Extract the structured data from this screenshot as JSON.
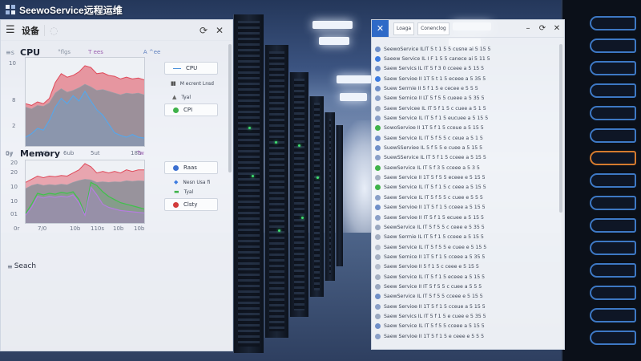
{
  "app": {
    "title": "SeewoService远程运维"
  },
  "device_panel": {
    "title": "设备",
    "faint_icon": "circle-icon",
    "header_buttons": [
      "refresh-icon",
      "close-icon"
    ]
  },
  "cpu": {
    "heading": "CPU",
    "icon_text": "≡s",
    "meta": [
      "°flgs",
      "T ees",
      "A ^ee"
    ],
    "x_ticks": [
      "0y",
      "10b",
      "6ub",
      "5ut",
      "18b"
    ],
    "y_ticks": [
      "10",
      "8",
      "2"
    ],
    "legend_buttons": [
      "CPU",
      "CPI"
    ],
    "legend_rows": [
      "M ecrent Lnsd",
      "Tyal"
    ],
    "colors": {
      "top": "#e04a5a",
      "mid": "#8a8f99",
      "low": "#58a6e8"
    }
  },
  "memory": {
    "heading": "Memory",
    "icon_text": "oy",
    "meta": [
      "Tw"
    ],
    "x_ticks": [
      "0r",
      "7/0",
      "10b",
      "110s",
      "10b",
      "10b"
    ],
    "y_ticks": [
      "20",
      "20",
      "10",
      "10",
      "01"
    ],
    "legend_buttons": [
      "Raas",
      "Clsty"
    ],
    "legend_rows": [
      "Nesn Usa fi",
      "Tyal"
    ],
    "colors": {
      "top": "#e04a5a",
      "mid": "#8a8f99",
      "green": "#3fc24a",
      "purple": "#b67ce0"
    }
  },
  "search": {
    "label": "Seach",
    "icon": "≡"
  },
  "chart_data": [
    {
      "type": "area",
      "title": "CPU",
      "xlabel": "",
      "ylabel": "",
      "x": [
        0,
        1,
        2,
        3,
        4,
        5,
        6,
        7,
        8,
        9,
        10,
        11,
        12,
        13,
        14,
        15,
        16,
        17,
        18,
        19,
        20
      ],
      "series": [
        {
          "values": [
            4.8,
            4.6,
            5.0,
            4.8,
            5.4,
            7.2,
            8.2,
            7.8,
            8.0,
            8.4,
            9.1,
            8.9,
            8.2,
            8.3,
            8.0,
            7.9,
            7.6,
            7.8,
            7.6,
            7.7,
            7.5
          ]
        },
        {
          "values": [
            4.4,
            4.2,
            4.6,
            4.5,
            4.9,
            6.0,
            6.5,
            6.1,
            6.3,
            6.6,
            7.0,
            6.7,
            6.3,
            6.4,
            6.2,
            6.0,
            5.8,
            6.0,
            5.9,
            6.0,
            5.8
          ]
        },
        {
          "values": [
            1.0,
            1.4,
            2.0,
            1.8,
            2.9,
            4.4,
            5.4,
            4.8,
            5.7,
            5.1,
            6.2,
            5.1,
            4.1,
            3.5,
            2.5,
            1.5,
            1.2,
            1.0,
            1.3,
            1.0,
            0.9
          ]
        }
      ]
    },
    {
      "type": "area",
      "title": "Memory",
      "xlabel": "",
      "ylabel": "",
      "x": [
        0,
        1,
        2,
        3,
        4,
        5,
        6,
        7,
        8,
        9,
        10,
        11,
        12,
        13,
        14,
        15,
        16,
        17,
        18,
        19,
        20
      ],
      "series": [
        {
          "values": [
            13,
            14,
            15,
            14.5,
            15,
            14.8,
            15.2,
            15,
            16,
            17,
            19,
            18,
            16,
            16.5,
            16,
            16.5,
            16,
            17,
            16.5,
            17,
            17
          ]
        },
        {
          "values": [
            11,
            12,
            12.5,
            12,
            12.3,
            12.1,
            12.4,
            12.2,
            13,
            13.6,
            14,
            13.8,
            13,
            13.2,
            13,
            13.2,
            13.1,
            13.5,
            13.3,
            13.5,
            13.4
          ]
        },
        {
          "values": [
            3,
            6,
            9.5,
            9,
            9.5,
            9.2,
            9.8,
            9.5,
            10,
            7.5,
            3,
            13,
            12,
            10,
            8.5,
            7.5,
            6.5,
            6,
            5.5,
            5,
            4.5
          ]
        },
        {
          "values": [
            2.5,
            5,
            8.5,
            8,
            8.5,
            8.2,
            8.6,
            8.3,
            9,
            6.5,
            2.5,
            11.5,
            9,
            6,
            5,
            4.5,
            4,
            3.8,
            3.6,
            3.4,
            3.2
          ]
        }
      ]
    }
  ],
  "log_panel": {
    "tabs": [
      "Loaga",
      "Conenclog"
    ],
    "window_buttons": [
      "minimize-icon",
      "restore-icon",
      "close-icon"
    ],
    "items": [
      {
        "text": "SeewoService  ILIT 5 t 1 5 5 cusne ai 5 15 5",
        "color": "#6f8fc8"
      },
      {
        "text": "Saeew Service  IL I F 1 5 5  canece ai 5 11 5",
        "color": "#3c7be0"
      },
      {
        "text": "Saew Servics  IL IT 5 f 3 0  cceee a 5 15 5",
        "color": "#6f8fc8"
      },
      {
        "text": "Saew Servioe  II 1T 5 t 1 5  eceee a 5 35 5",
        "color": "#3c7be0"
      },
      {
        "text": "Suew Serrnie  II  5 f 1 5  e cecee e 5 5 5",
        "color": "#6f8fc8"
      },
      {
        "text": "Saew Sernice  II LT 5 f 5 5  cueee a 5 35 5",
        "color": "#8aa0c8"
      },
      {
        "text": "Saew Servicee  IL IT 5 f 1 5  c cuee a 5 1 5",
        "color": "#9aa8c0"
      },
      {
        "text": "Saew Service  IL IT 5 f 1 5  eucuee a 5 15 5",
        "color": "#8aa0c8"
      },
      {
        "text": "SowoServioe  II 1T 5 f 1 5  cceue a 5 15 5",
        "color": "#3fb24a"
      },
      {
        "text": "Saew Service  IL IT 5 f 5 5  c ceue a 5 1 5",
        "color": "#6f8fc8"
      },
      {
        "text": "SuewSServiee  IL  5 f 5 5  e cuee a 5 15 5",
        "color": "#6f8fc8"
      },
      {
        "text": "SuewSService  IL IT 5 f 1 5  cceee a 5 15 5",
        "color": "#8aa0c8"
      },
      {
        "text": "SaewService  IL IT 5 f 3 5  cceee a 5 3 5",
        "color": "#3fb24a"
      },
      {
        "text": "Saew Service  II 1T 5 f 5 5  eceee e 5 15 5",
        "color": "#a5b0c2"
      },
      {
        "text": "Saew Service  IL IT 5 f 1 5  c ceee a 5 15 5",
        "color": "#3fb24a"
      },
      {
        "text": "Saew Service  IL IT 5 f 5 5  c cuee e 5 5 5",
        "color": "#8aa0c8"
      },
      {
        "text": "Saew Servioe  II 1T 5 f 1 5  cceee a 5 15 5",
        "color": "#6f8fc8"
      },
      {
        "text": "Saew Servioe  II IT 5 f 1 5  ecuee a 5 15 5",
        "color": "#8aa0c8"
      },
      {
        "text": "SeewService  IL IT 5 f 5 5  c ceee e 5 35 5",
        "color": "#9aa8c0"
      },
      {
        "text": "Saew Serrnie  IL IT 5 f 1 5  cceee a 5 15 5",
        "color": "#a5b0c2"
      },
      {
        "text": "Saew Service  IL IT 5 f 5 5  e cuee e 5 15 5",
        "color": "#b4bdcc"
      },
      {
        "text": "Saew Sernice  II 1T 5 f 1 5  cceee a 5 35 5",
        "color": "#a5b0c2"
      },
      {
        "text": "Saew Servioe  II  5 f 1 5  c ceee e 5 15 5",
        "color": "#b4bdcc"
      },
      {
        "text": "Saew Service  IL IT 5 f 1 5  eceee a 5 15 5",
        "color": "#a5b0c2"
      },
      {
        "text": "Seew Service  II IT 5 f 5 5  c cuee a 5 5 5",
        "color": "#9aa8c0"
      },
      {
        "text": "SaewService  IL IT 5 f 5 5  cceee e 5 15 5",
        "color": "#6f8fc8"
      },
      {
        "text": "Saew Servioe  II 1T 5 f 1 5  cceue a 5 15 5",
        "color": "#8aa0c8"
      },
      {
        "text": "Saew Servics  IL IT 5 f 1 5  e cuee e 5 35 5",
        "color": "#9aa8c0"
      },
      {
        "text": "Saew Service  IL IT 5 f 5 5  cceee a 5 15 5",
        "color": "#6f8fc8"
      },
      {
        "text": "Saew Servioe  II 1T 5 f 1 5  e ceee e 5 5 5",
        "color": "#8aa0c8"
      }
    ]
  }
}
